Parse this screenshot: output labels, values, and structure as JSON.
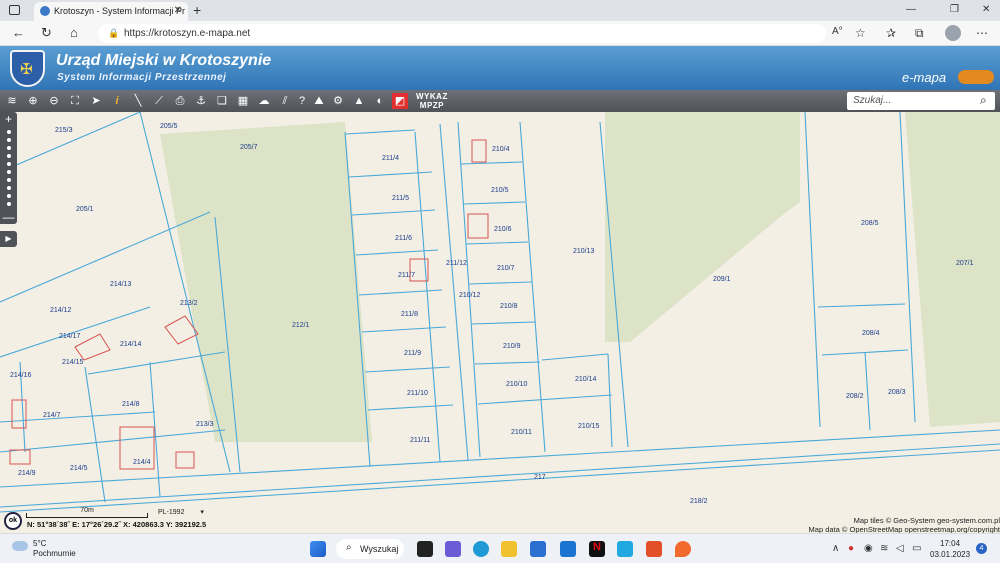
{
  "browser": {
    "tab_title": "Krotoszyn - System Informacji Pr",
    "url": "https://krotoszyn.e-mapa.net"
  },
  "header": {
    "title": "Urząd Miejski w Krotoszynie",
    "subtitle": "System Informacji Przestrzennej",
    "brand": "e-mapa"
  },
  "toolbar": {
    "wykaz_line1": "WYKAZ",
    "wykaz_line2": "MPZP",
    "search_placeholder": "Szukaj...",
    "tools": [
      "layers-icon",
      "zoom-in-icon",
      "zoom-out-icon",
      "full-extent-icon",
      "pointer-icon",
      "info-icon",
      "measure-line-icon",
      "measure-area-icon",
      "print-icon",
      "anchor-icon",
      "copy-icon",
      "layout-icon",
      "cloud-shape-icon",
      "hatch-icon",
      "help-icon",
      "mountains-icon",
      "cloud-upload-icon",
      "settings-icon",
      "triangle-icon",
      "toggle-icon",
      "red-flag-icon"
    ]
  },
  "map": {
    "parcels": [
      "215/3",
      "205/5",
      "205/7",
      "205/1",
      "214/13",
      "214/12",
      "213/2",
      "214/17",
      "214/14",
      "214/15",
      "214/16",
      "214/7",
      "214/8",
      "214/9",
      "214/5",
      "214/4",
      "213/3",
      "212/1",
      "211/4",
      "211/5",
      "211/6",
      "211/7",
      "211/12",
      "211/8",
      "211/9",
      "211/10",
      "211/11",
      "210/4",
      "210/5",
      "210/6",
      "210/7",
      "210/12",
      "210/8",
      "210/9",
      "210/10",
      "210/11",
      "210/13",
      "210/14",
      "210/15",
      "209/1",
      "208/5",
      "208/4",
      "208/2",
      "208/3",
      "207/1",
      "217",
      "218/2"
    ],
    "scale_label": "70m",
    "crs": "PL-1992",
    "ok_label": "ok",
    "coords": "N: 51°38´38˝    E: 17°26´29.2˝    X: 420863.3    Y: 392192.5",
    "attribution_1": "Map tiles © Geo-System geo-system.com.pl",
    "attribution_2": "Map data © OpenStreetMap openstreetmap.org/copyright"
  },
  "taskbar": {
    "temperature": "5°C",
    "weather": "Pochmurnie",
    "search_label": "Wyszukaj",
    "time": "17:04",
    "date": "03.01.2023",
    "notification_count": "4"
  },
  "colors": {
    "header": "#2f74b5",
    "field": "#dde3c7",
    "parcel_line": "#4aa8d8",
    "building": "#d9534f",
    "label": "#1a3c8c"
  }
}
